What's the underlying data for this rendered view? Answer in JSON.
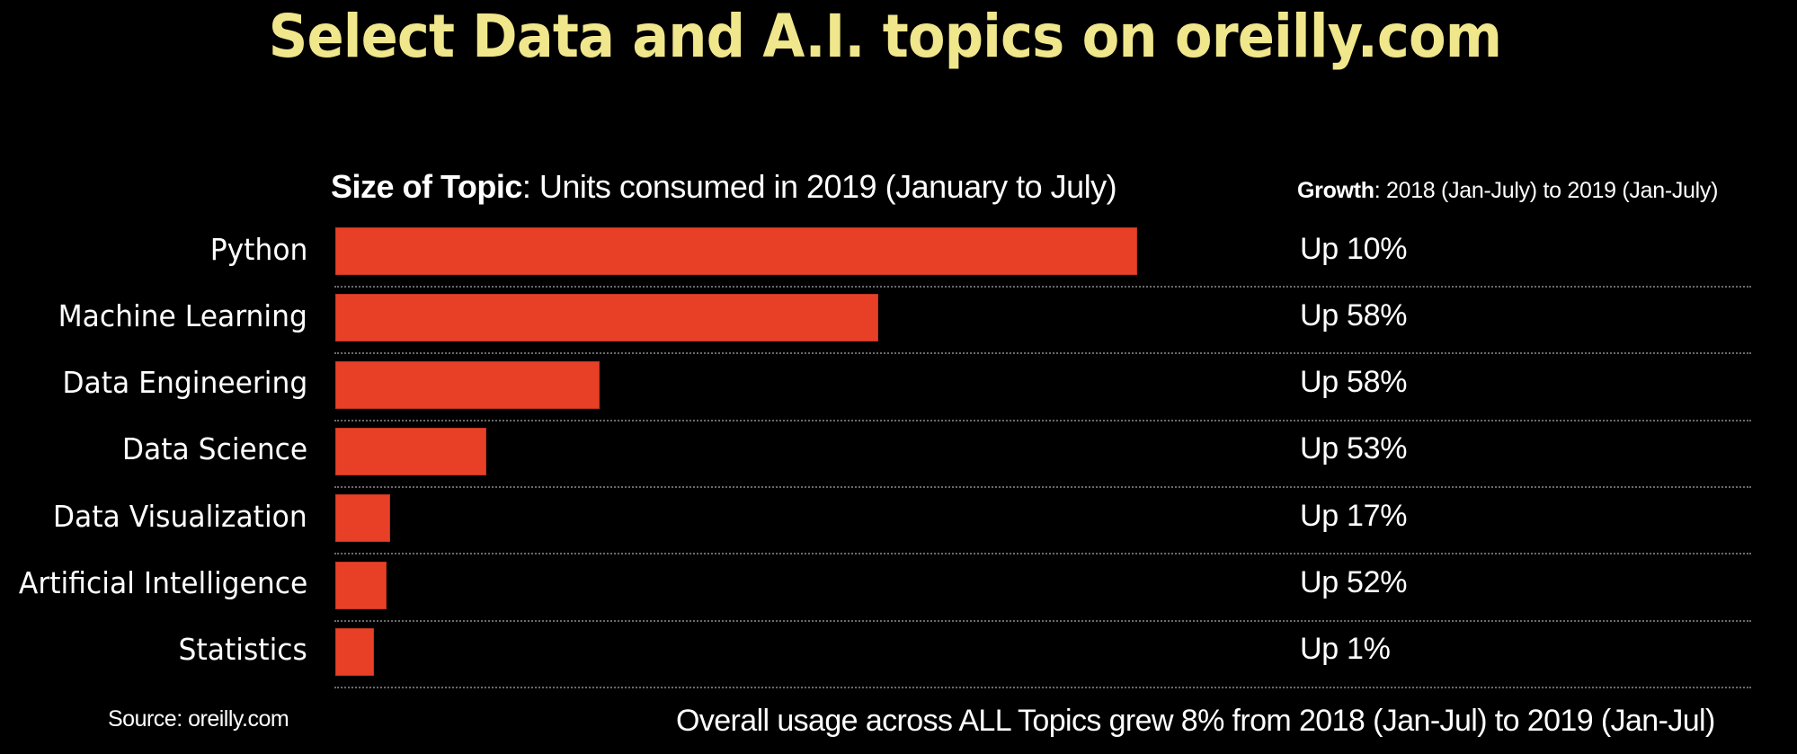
{
  "chart_data": {
    "type": "bar",
    "orientation": "horizontal",
    "title": "Select Data and A.I. topics on oreilly.com",
    "subtitle_bold": "Size of Topic",
    "subtitle_rest": ": Units consumed in 2019 (January to July)",
    "growth_header_bold": "Growth",
    "growth_header_rest": ": 2018 (Jan-July)  to 2019 (Jan-July)",
    "categories": [
      "Python",
      "Machine Learning",
      "Data Engineering",
      "Data Science",
      "Data Visualization",
      "Artificial Intelligence",
      "Statistics"
    ],
    "values_relative_to_python": [
      100,
      67.7,
      33.0,
      18.8,
      6.8,
      6.4,
      4.8
    ],
    "value_note": "No axis shown; bar lengths estimated relative to Python = 100",
    "growth_labels": [
      "Up 10%",
      "Up 58%",
      "Up 58%",
      "Up 53%",
      "Up 17%",
      "Up 52%",
      "Up 1%"
    ],
    "growth_percent": [
      10,
      58,
      58,
      53,
      17,
      52,
      1
    ],
    "xlabel": "",
    "ylabel": "",
    "grid": false,
    "legend": "none",
    "source": "Source: oreilly.com",
    "footnote": "Overall usage across ALL Topics grew 8% from 2018 (Jan-Jul) to 2019 (Jan-Jul)"
  },
  "colors": {
    "background": "#000000",
    "title": "#f0e68c",
    "bar": "#e84027",
    "text": "#ffffff",
    "divider": "#6a6a6a"
  }
}
